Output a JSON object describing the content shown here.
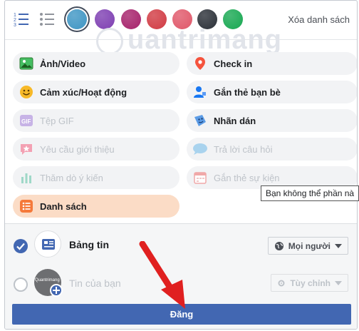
{
  "toolbar": {
    "clear_label": "Xóa danh sách",
    "colors": [
      "#3f96c4",
      "#7e3fb2",
      "#a6226b",
      "#d13b43",
      "#e0586a",
      "#2b3038",
      "#18a852"
    ]
  },
  "watermark": {
    "text": "uantrimang"
  },
  "options": {
    "left": [
      {
        "label": "Ảnh/Video",
        "icon": "photo-icon",
        "state": "normal"
      },
      {
        "label": "Cảm xúc/Hoạt động",
        "icon": "smiley-icon",
        "state": "normal"
      },
      {
        "label": "Tệp GIF",
        "icon": "gif-icon",
        "state": "dim"
      },
      {
        "label": "Yêu cầu giới thiệu",
        "icon": "recommend-icon",
        "state": "dim"
      },
      {
        "label": "Thăm dò ý kiến",
        "icon": "poll-icon",
        "state": "dim"
      },
      {
        "label": "Danh sách",
        "icon": "list-icon",
        "state": "active"
      }
    ],
    "right": [
      {
        "label": "Check in",
        "icon": "location-pin-icon",
        "state": "normal"
      },
      {
        "label": "Gắn thẻ bạn bè",
        "icon": "tag-friends-icon",
        "state": "normal"
      },
      {
        "label": "Nhãn dán",
        "icon": "sticker-icon",
        "state": "normal"
      },
      {
        "label": "Trả lời câu hỏi",
        "icon": "question-icon",
        "state": "dim"
      },
      {
        "label": "Gắn thẻ sự kiện",
        "icon": "calendar-icon",
        "state": "dim"
      }
    ]
  },
  "tooltip": {
    "text": "Bạn không thể phần nà"
  },
  "destinations": {
    "feed": {
      "label": "Bảng tin",
      "audience": "Mọi người"
    },
    "story": {
      "label": "Tin của bạn",
      "audience": "Tùy chỉnh",
      "thumb_text": "Quantrimang"
    }
  },
  "post_button": {
    "label": "Đăng"
  }
}
